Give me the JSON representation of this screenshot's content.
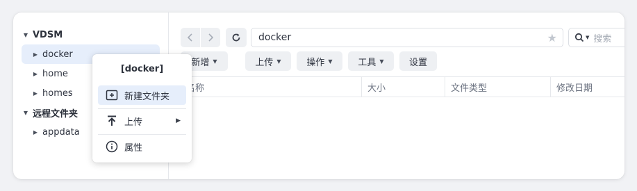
{
  "sidebar": {
    "roots": [
      {
        "label": "VDSM",
        "children": [
          "docker",
          "home",
          "homes"
        ]
      },
      {
        "label": "远程文件夹",
        "children": [
          "appdata"
        ]
      }
    ]
  },
  "toolbar": {
    "path_value": "docker",
    "search_placeholder": "搜索",
    "buttons": [
      "新增",
      "上传",
      "操作",
      "工具",
      "设置"
    ]
  },
  "table": {
    "columns": [
      "名称",
      "大小",
      "文件类型",
      "修改日期"
    ]
  },
  "context_menu": {
    "title": "[docker]",
    "items": [
      "新建文件夹",
      "上传",
      "属性"
    ]
  },
  "colors": {
    "accent_highlight": "#e6eefb",
    "button_bg": "#eef0f3",
    "border": "#e6e8ec"
  }
}
